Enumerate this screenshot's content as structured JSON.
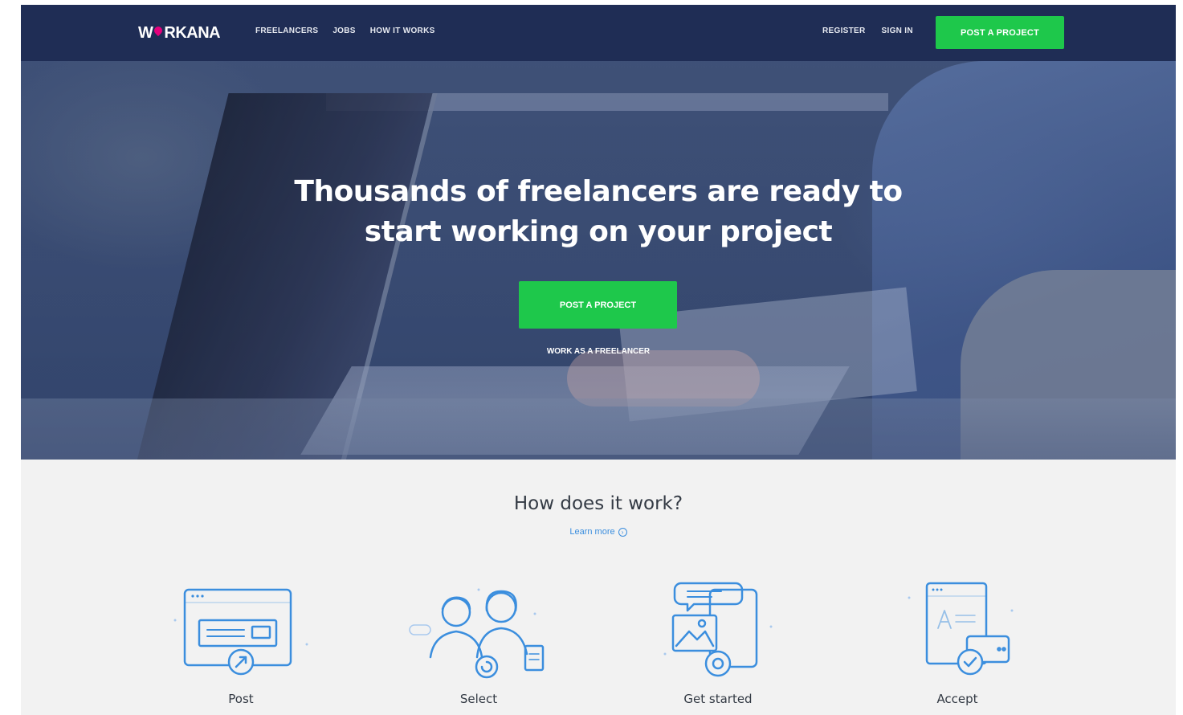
{
  "nav": {
    "logo": "WORKANA",
    "links": [
      "FREELANCERS",
      "JOBS",
      "HOW IT WORKS"
    ],
    "register": "REGISTER",
    "sign_in": "SIGN IN",
    "cta": "POST A PROJECT"
  },
  "hero": {
    "title_line1": "Thousands of freelancers are ready to",
    "title_line2": "start working on your project",
    "cta": "POST A PROJECT",
    "secondary_link": "WORK AS A FREELANCER"
  },
  "how": {
    "title": "How does it work?",
    "learn_more": "Learn more",
    "steps": [
      {
        "label": "Post",
        "icon": "browser-post-icon"
      },
      {
        "label": "Select",
        "icon": "people-select-icon"
      },
      {
        "label": "Get started",
        "icon": "devices-chat-icon"
      },
      {
        "label": "Accept",
        "icon": "document-accept-icon"
      }
    ]
  },
  "colors": {
    "nav_bg": "#1f2d55",
    "accent_green": "#1ec84b",
    "logo_pink": "#e4007c",
    "icon_blue": "#3b8ede",
    "section_bg": "#f2f2f2"
  }
}
